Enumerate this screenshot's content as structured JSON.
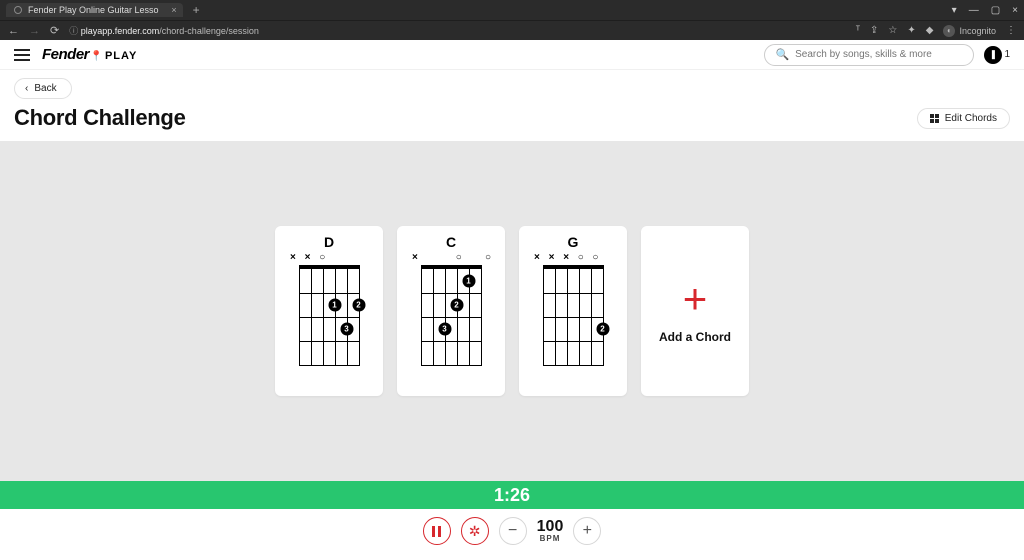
{
  "browser": {
    "tab_title": "Fender Play Online Guitar Lesso",
    "url_host": "playapp.fender.com",
    "url_path": "/chord-challenge/session",
    "incognito_label": "Incognito"
  },
  "header": {
    "brand_script": "Fender",
    "brand_block": "PLAY",
    "search_placeholder": "Search by songs, skills & more",
    "streak_icon": "⬤",
    "streak_count": "1"
  },
  "nav": {
    "back_label": "Back"
  },
  "page": {
    "title": "Chord Challenge",
    "edit_chords_label": "Edit Chords"
  },
  "chords": [
    {
      "name": "D",
      "open": [
        "×",
        "×",
        "○",
        "",
        "",
        ""
      ],
      "dots": [
        {
          "string": 3,
          "fret": 2,
          "finger": "1"
        },
        {
          "string": 5,
          "fret": 2,
          "finger": "2"
        },
        {
          "string": 4,
          "fret": 3,
          "finger": "3"
        }
      ]
    },
    {
      "name": "C",
      "open": [
        "×",
        "",
        "",
        "○",
        "",
        "○"
      ],
      "dots": [
        {
          "string": 4,
          "fret": 1,
          "finger": "1"
        },
        {
          "string": 3,
          "fret": 2,
          "finger": "2"
        },
        {
          "string": 2,
          "fret": 3,
          "finger": "3"
        }
      ]
    },
    {
      "name": "G",
      "open": [
        "×",
        "×",
        "×",
        "○",
        "○",
        ""
      ],
      "dots": [
        {
          "string": 5,
          "fret": 3,
          "finger": "2"
        }
      ]
    }
  ],
  "add_chord_label": "Add a Chord",
  "timer": "1:26",
  "controls": {
    "bpm_value": "100",
    "bpm_label": "BPM",
    "minus": "−",
    "plus": "+"
  }
}
